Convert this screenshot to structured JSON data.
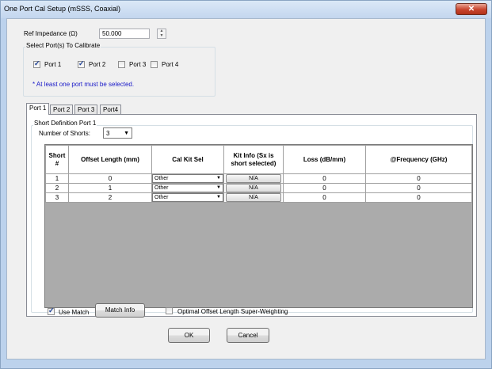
{
  "window": {
    "title": "One Port Cal Setup (mSSS, Coaxial)",
    "close_label": "✕"
  },
  "ref_impedance": {
    "label": "Ref Impedance (Ω)",
    "value": "50.000"
  },
  "port_select": {
    "legend": "Select Port(s) To Calibrate",
    "ports": [
      {
        "label": "Port 1",
        "checked": true
      },
      {
        "label": "Port 2",
        "checked": true
      },
      {
        "label": "Port 3",
        "checked": false
      },
      {
        "label": "Port 4",
        "checked": false
      }
    ],
    "note": "* At least one port must be selected."
  },
  "tabs": [
    "Port 1",
    "Port 2",
    "Port 3",
    "Port4"
  ],
  "short_definition": {
    "legend": "Short Definition Port 1",
    "num_shorts_label": "Number of Shorts:",
    "num_shorts_value": "3"
  },
  "table": {
    "headers": [
      "Short #",
      "Offset Length (mm)",
      "Cal Kit Sel",
      "Kit Info (Sx is short selected)",
      "Loss (dB/mm)",
      "@Frequency (GHz)"
    ],
    "rows": [
      {
        "short": "1",
        "offset": "0",
        "kit_sel": "Other",
        "kit_info": "N/A",
        "loss": "0",
        "freq": "0"
      },
      {
        "short": "2",
        "offset": "1",
        "kit_sel": "Other",
        "kit_info": "N/A",
        "loss": "0",
        "freq": "0"
      },
      {
        "short": "3",
        "offset": "2",
        "kit_sel": "Other",
        "kit_info": "N/A",
        "loss": "0",
        "freq": "0"
      }
    ]
  },
  "use_match": {
    "label": "Use Match",
    "checked": true
  },
  "match_info_label": "Match Info",
  "optimal_offset": {
    "label": "Optimal Offset Length Super-Weighting",
    "checked": false
  },
  "ok_label": "OK",
  "cancel_label": "Cancel"
}
